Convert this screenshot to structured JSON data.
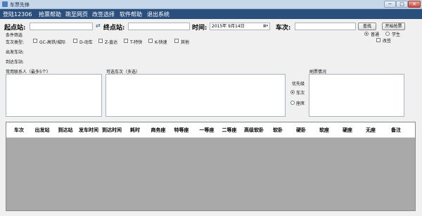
{
  "window": {
    "title": "车票先锋",
    "min": "─",
    "max": "□",
    "close": "✕"
  },
  "menu": [
    "登陆12306",
    "抢票帮助",
    "跳至网页",
    "改签选择",
    "软件帮助",
    "退出系统"
  ],
  "search": {
    "from_label": "起点站:",
    "from_value": "",
    "swap_icon": "⇄",
    "to_label": "终点站:",
    "to_value": "",
    "date_label": "时间:",
    "date_value": "2015年 9月14日",
    "date_dropdown": "▦▾",
    "train_label": "车次:",
    "train_value": "",
    "query_button": "查找",
    "start_button": "开始抢票"
  },
  "options": {
    "seat_kind": {
      "normal": "普通",
      "student": "学生",
      "selected": "normal"
    },
    "change_ticket": "改签",
    "filter_label": "条件筛选",
    "train_type_label": "车次类型:",
    "train_types": [
      {
        "label": "GC-高铁/城际",
        "checked": false
      },
      {
        "label": "D-动车",
        "checked": false
      },
      {
        "label": "Z-直达",
        "checked": false
      },
      {
        "label": "T-特快",
        "checked": false
      },
      {
        "label": "K-快速",
        "checked": false
      },
      {
        "label": "其他",
        "checked": false
      }
    ],
    "depart_station_label": "出发车站:",
    "arrive_station_label": "到达车站:"
  },
  "panels": {
    "contacts_label": "常用联系人（最多5个）",
    "trains_label": "可选车次（多选）",
    "priority_label": "优先级",
    "priority_train": "车次",
    "priority_seat": "座席",
    "priority_selected": "train",
    "refresh_label": "刷票情况"
  },
  "grid": {
    "columns": [
      "车次",
      "出发站",
      "到达站",
      "发车时间",
      "到达时间",
      "耗时",
      "商务座",
      "特等座",
      "一等座",
      "二等座",
      "高级软卧",
      "软卧",
      "硬卧",
      "软座",
      "硬座",
      "无座",
      "备注"
    ]
  }
}
